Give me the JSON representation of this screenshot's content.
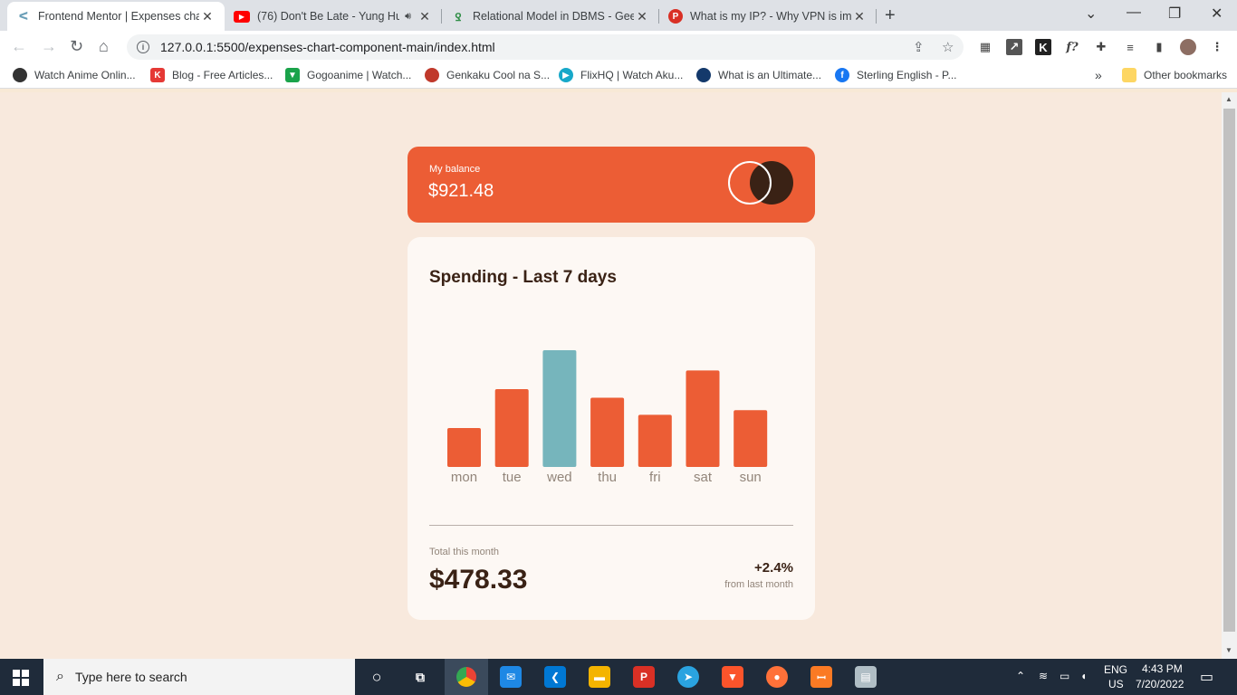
{
  "browser": {
    "tabs": [
      {
        "title": "Frontend Mentor | Expenses char",
        "icon": "frontend-mentor-icon",
        "color": "#a9c6d6",
        "active": true
      },
      {
        "title": "(76) Don't Be Late - Yung Hu",
        "icon": "youtube-icon",
        "color": "#ff0000",
        "active": false
      },
      {
        "title": "Relational Model in DBMS - Geek",
        "icon": "geeksforgeeks-icon",
        "color": "#2f8d46",
        "active": false
      },
      {
        "title": "What is my IP? - Why VPN is imp",
        "icon": "psiphon-icon",
        "color": "#d93025",
        "active": false
      }
    ],
    "new_tab_label": "+",
    "url": "127.0.0.1:5500/expenses-chart-component-main/index.html",
    "bookmarks": [
      {
        "label": "Watch Anime Onlin...",
        "color": "#333333"
      },
      {
        "label": "Blog - Free Articles...",
        "color": "#e53935"
      },
      {
        "label": "Gogoanime | Watch...",
        "color": "#1aa34a"
      },
      {
        "label": "Genkaku Cool na S...",
        "color": "#c0392b"
      },
      {
        "label": "FlixHQ | Watch Aku...",
        "color": "#17a8c9"
      },
      {
        "label": "What is an Ultimate...",
        "color": "#14396b"
      },
      {
        "label": "Sterling English - P...",
        "color": "#1877f2"
      }
    ],
    "more_bookmarks": "»",
    "other_bookmarks": "Other bookmarks"
  },
  "app": {
    "balance_label": "My balance",
    "balance_amount": "$921.48",
    "spending_title": "Spending - Last 7 days",
    "total_label": "Total this month",
    "total_amount": "$478.33",
    "change_pct": "+2.4%",
    "change_label": "from last month",
    "colors": {
      "bar": "#ec5d35",
      "bar_highlight": "#76b5bc",
      "dark": "#3a2215",
      "bg": "#f8e9dd"
    }
  },
  "chart_data": {
    "type": "bar",
    "categories": [
      "mon",
      "tue",
      "wed",
      "thu",
      "fri",
      "sat",
      "sun"
    ],
    "values": [
      17.45,
      34.91,
      52.36,
      31.07,
      23.39,
      43.28,
      25.48
    ],
    "highlight": "wed",
    "xlabel": "",
    "ylabel": "",
    "grid": false
  },
  "taskbar": {
    "search_placeholder": "Type here to search",
    "apps": [
      "cortana-icon",
      "task-view-icon",
      "chrome-icon",
      "mail-icon",
      "vscode-icon",
      "file-explorer-icon",
      "psiphon-icon",
      "telegram-icon",
      "brave-icon",
      "firefox-icon",
      "xampp-icon",
      "notepad-icon"
    ],
    "lang_top": "ENG",
    "lang_bottom": "US",
    "time": "4:43 PM",
    "date": "7/20/2022"
  }
}
